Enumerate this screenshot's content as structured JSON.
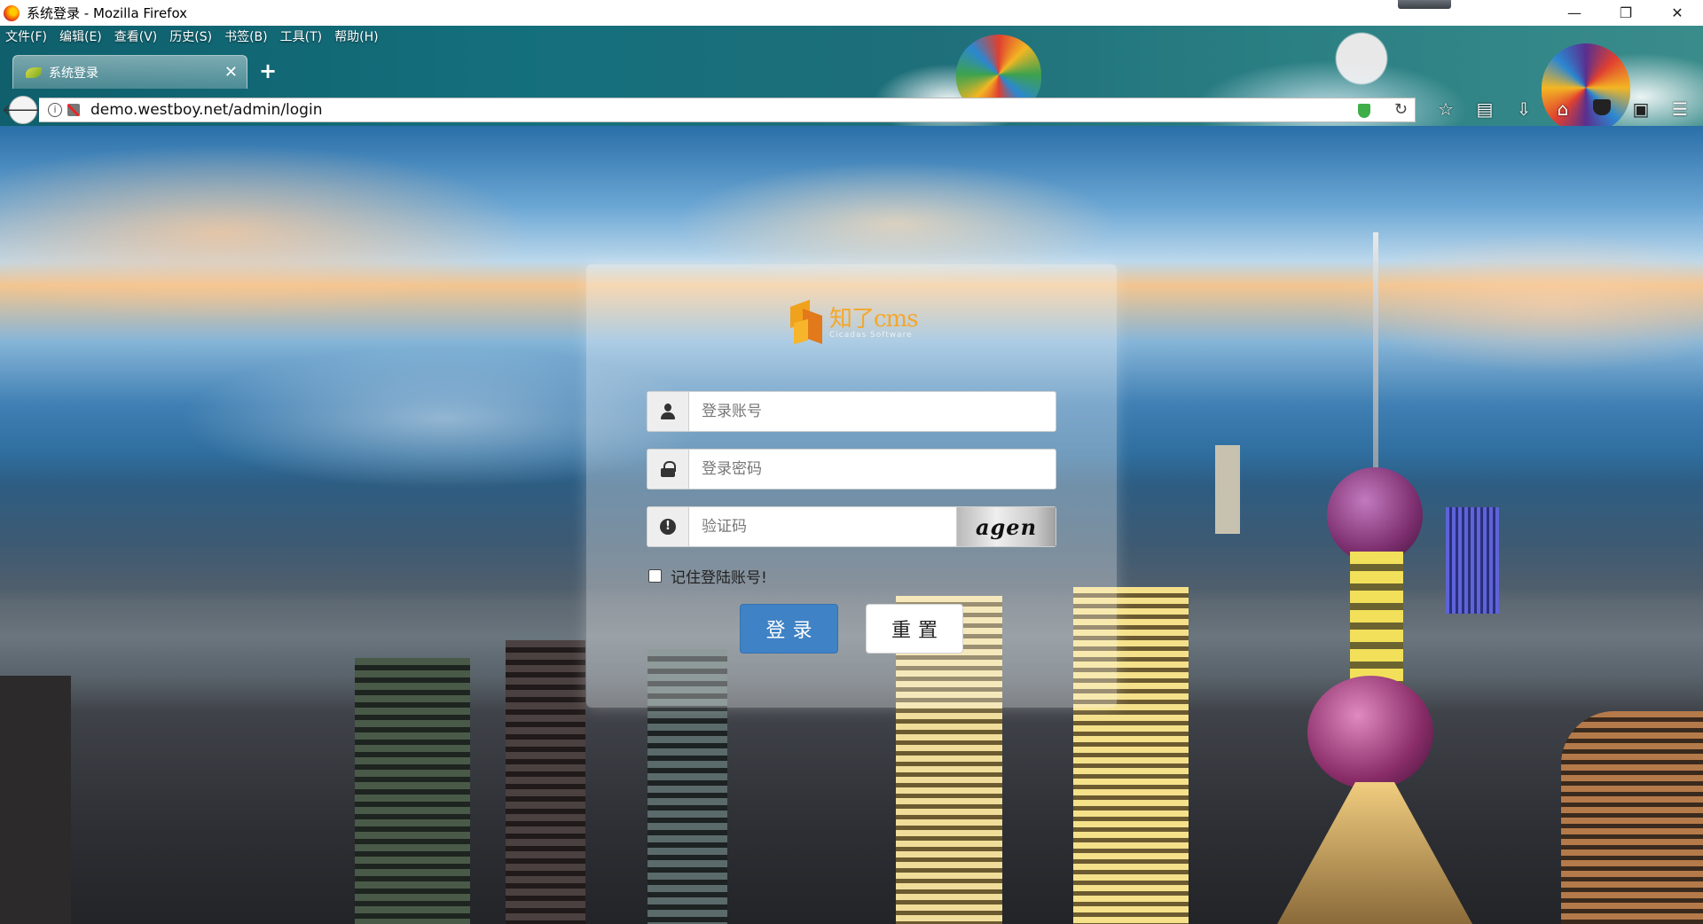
{
  "window": {
    "title": "系统登录 - Mozilla Firefox",
    "minimize": "—",
    "restore": "❐",
    "close": "✕"
  },
  "menubar": {
    "items": [
      "文件(F)",
      "编辑(E)",
      "查看(V)",
      "历史(S)",
      "书签(B)",
      "工具(T)",
      "帮助(H)"
    ]
  },
  "tabs": [
    {
      "label": "系统登录",
      "close": "✕"
    }
  ],
  "newtab": "+",
  "navbar": {
    "back": "🡐",
    "url": "demo.westboy.net/admin/login",
    "reload": "↻",
    "info_glyph": "i",
    "icons": [
      "star-icon",
      "reader-icon",
      "download-icon",
      "home-icon",
      "pocket-icon",
      "translate-icon",
      "menu-icon"
    ]
  },
  "login": {
    "logo_text": "知了cms",
    "logo_sub": "Cicadas Software",
    "username_placeholder": "登录账号",
    "password_placeholder": "登录密码",
    "captcha_placeholder": "验证码",
    "captcha_text": "agen",
    "remember_label": "记住登陆账号!",
    "login_button": "登录",
    "reset_button": "重置",
    "alert_glyph": "!"
  },
  "colors": {
    "primary": "#3f82c5",
    "logo": "#f4a72b"
  }
}
